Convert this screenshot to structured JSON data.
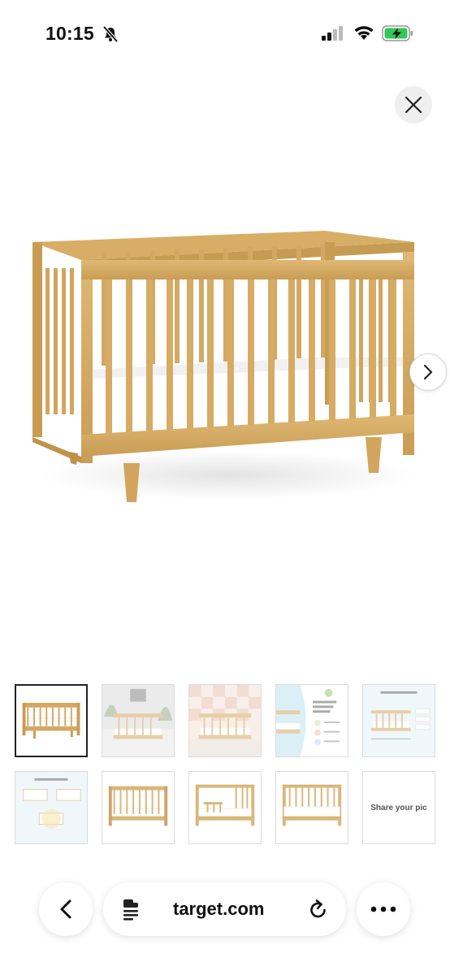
{
  "status_bar": {
    "time": "10:15",
    "icons": [
      "bell-slash-icon",
      "cellular-signal-icon",
      "wifi-icon",
      "battery-charging-icon"
    ],
    "battery_color": "#34c759"
  },
  "viewer": {
    "close_icon": "close-icon",
    "next_icon": "chevron-right-icon",
    "image_subject": "crib-product-image"
  },
  "thumbnails": [
    {
      "id": "crib-front",
      "selected": true
    },
    {
      "id": "crib-room-scene",
      "selected": false
    },
    {
      "id": "crib-checker-wall",
      "selected": false
    },
    {
      "id": "crib-feature-panel",
      "selected": false
    },
    {
      "id": "crib-dimensions",
      "selected": false
    },
    {
      "id": "crib-conversions",
      "selected": false
    },
    {
      "id": "crib-front-alt",
      "selected": false
    },
    {
      "id": "toddler-bed",
      "selected": false
    },
    {
      "id": "daybed",
      "selected": false
    },
    {
      "id": "share-your-pic",
      "selected": false,
      "label": "Share your pic"
    }
  ],
  "browser": {
    "url": "target.com",
    "back_icon": "chevron-left-icon",
    "reader_icon": "reader-mode-icon",
    "reload_icon": "reload-icon",
    "more_icon": "more-icon"
  },
  "colors": {
    "wood": "#d9b06d",
    "wood_dark": "#c39a55",
    "mattress": "#ffffff"
  }
}
